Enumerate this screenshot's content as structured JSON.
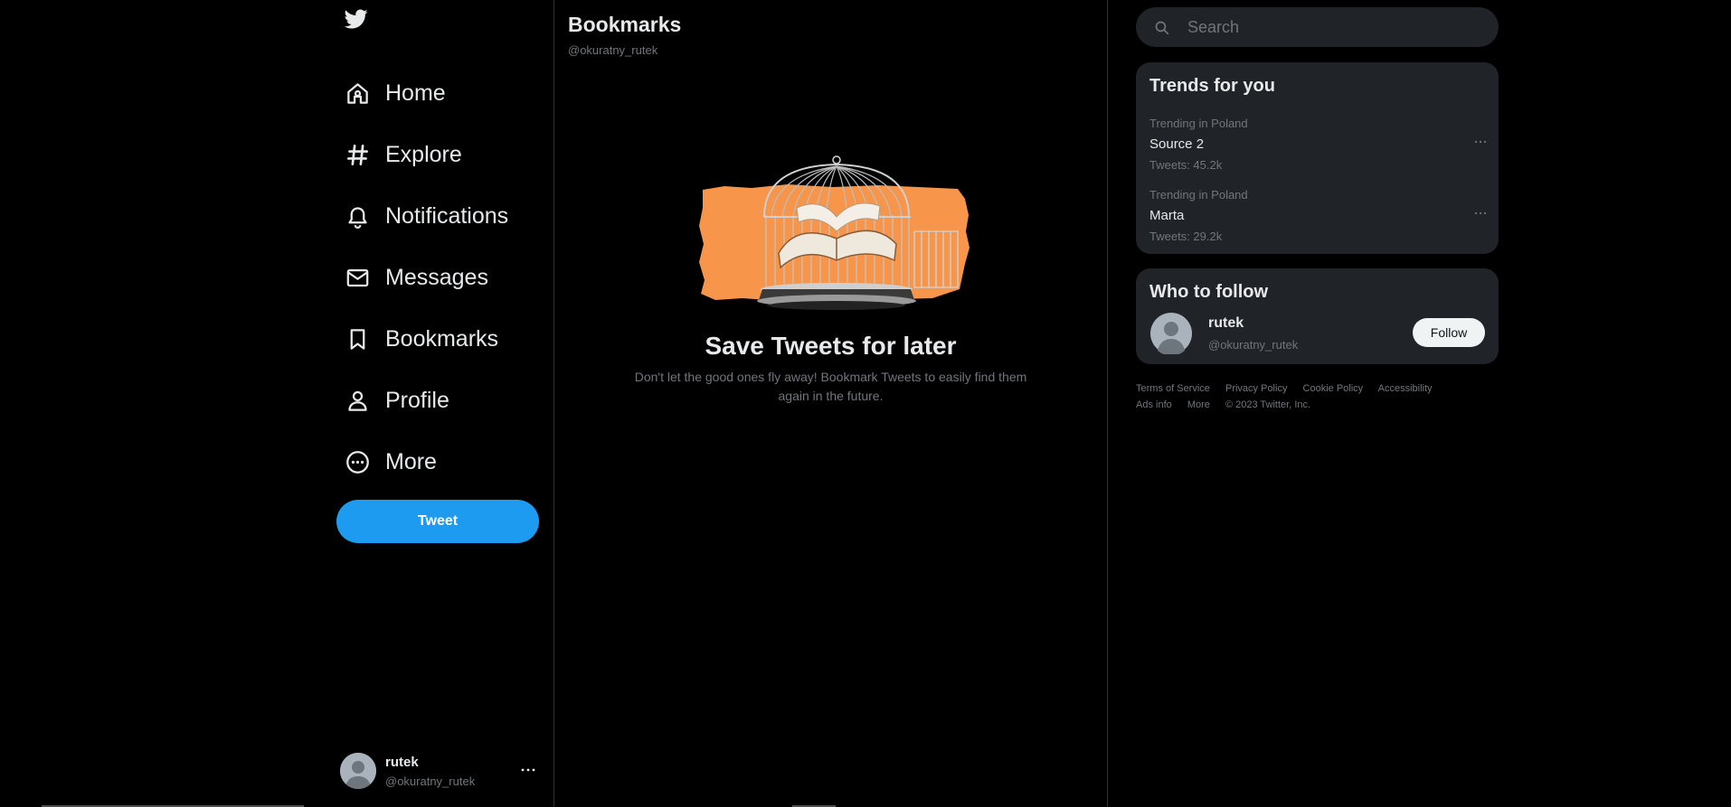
{
  "app": {
    "name": "Twitter"
  },
  "nav": {
    "items": [
      {
        "label": "Home",
        "icon": "home-icon"
      },
      {
        "label": "Explore",
        "icon": "hashtag-icon"
      },
      {
        "label": "Notifications",
        "icon": "bell-icon"
      },
      {
        "label": "Messages",
        "icon": "envelope-icon"
      },
      {
        "label": "Bookmarks",
        "icon": "bookmark-icon"
      },
      {
        "label": "Profile",
        "icon": "person-icon"
      },
      {
        "label": "More",
        "icon": "more-circle-icon"
      }
    ],
    "tweet_label": "Tweet"
  },
  "account": {
    "name": "rutek",
    "handle": "@okuratny_rutek"
  },
  "main": {
    "title": "Bookmarks",
    "subtitle": "@okuratny_rutek",
    "empty_title": "Save Tweets for later",
    "empty_body": "Don't let the good ones fly away! Bookmark Tweets to easily find them again in the future."
  },
  "search": {
    "placeholder": "Search"
  },
  "trends": {
    "title": "Trends for you",
    "items": [
      {
        "context": "Trending in Poland",
        "name": "Source 2",
        "count": "Tweets: 45.2k"
      },
      {
        "context": "Trending in Poland",
        "name": "Marta",
        "count": "Tweets: 29.2k"
      }
    ]
  },
  "who_to_follow": {
    "title": "Who to follow",
    "name": "rutek",
    "handle": "@okuratny_rutek",
    "follow_label": "Follow"
  },
  "footer": {
    "links": [
      "Terms of Service",
      "Privacy Policy",
      "Cookie Policy",
      "Accessibility",
      "Ads info",
      "More"
    ],
    "copyright": "© 2023 Twitter, Inc."
  },
  "colors": {
    "accent": "#1d9bf0",
    "background": "#000000",
    "panel": "#202327",
    "illustration_orange": "#f7954a"
  }
}
